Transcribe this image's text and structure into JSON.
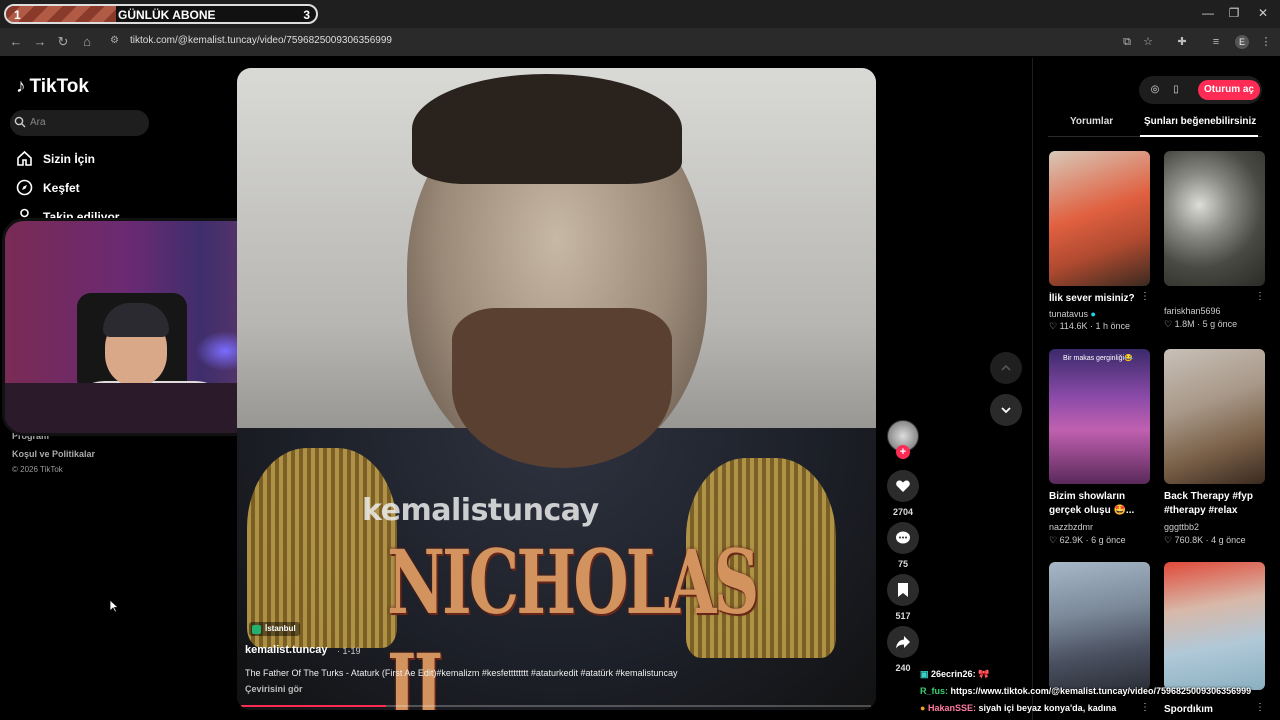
{
  "stream_banner": {
    "left_num": "1",
    "title": "GÜNLÜK ABONE",
    "right_num": "3"
  },
  "browser": {
    "url": "tiktok.com/@kemalist.tuncay/video/7596825009306356999",
    "profile_initial": "E"
  },
  "sidebar": {
    "logo": "TikTok",
    "search_placeholder": "Ara",
    "nav": [
      {
        "label": "Sizin İçin",
        "icon": "home-icon"
      },
      {
        "label": "Keşfet",
        "icon": "compass-icon"
      },
      {
        "label": "Takip ediliyor",
        "icon": "user-icon"
      }
    ],
    "footer_links": [
      "Program",
      "Koşul ve Politikalar"
    ],
    "copyright": "© 2026 TikTok"
  },
  "video": {
    "watermark": "kemalistuncay",
    "big_title": "NICHOLAS II",
    "location": "İstanbul",
    "author": "kemalist.tuncay",
    "date": "· 1-19",
    "description": "The Father Of The Turks - Ataturk (First Ae Edit)#kemalizm #kesfetttttttt #ataturkedit #atatürk #kemalistuncay",
    "translate": "Çevirisini gör",
    "progress": 0.23
  },
  "actions": {
    "likes": "2704",
    "comments": "75",
    "saves": "517",
    "shares": "240"
  },
  "right_panel": {
    "login": "Oturum aç",
    "tabs": [
      "Yorumlar",
      "Şunları beğenebilirsiniz"
    ],
    "cards": [
      {
        "title": "İlik sever misiniz?",
        "author": "tunatavus",
        "verified": true,
        "meta": "114.6K · 1 h önce"
      },
      {
        "title": "",
        "author": "fariskhan5696",
        "verified": false,
        "meta": "1.8M · 5 g önce"
      },
      {
        "title": "Bizim showların gerçek oluşu 🤩...",
        "author": "nazzbzdmr",
        "verified": false,
        "meta": "62.9K · 6 g önce",
        "overlay": "Bir makas gerginliği😂"
      },
      {
        "title": "Back Therapy #fyp #therapy #relax",
        "author": "gggttbb2",
        "verified": false,
        "meta": "760.8K · 4 g önce"
      },
      {
        "title": "",
        "author": "",
        "verified": false,
        "meta": ""
      },
      {
        "title": "Spordıkım",
        "author": "",
        "verified": false,
        "meta": ""
      }
    ]
  },
  "chat": [
    {
      "user": "26ecrin26:",
      "text": "🎀"
    },
    {
      "user": "R_fus:",
      "text": "https://www.tiktok.com/@kemalist.tuncay/video/7596825009306356999"
    },
    {
      "user": "HakanSSE:",
      "text": "siyah içi beyaz konya'da, kadına"
    }
  ]
}
